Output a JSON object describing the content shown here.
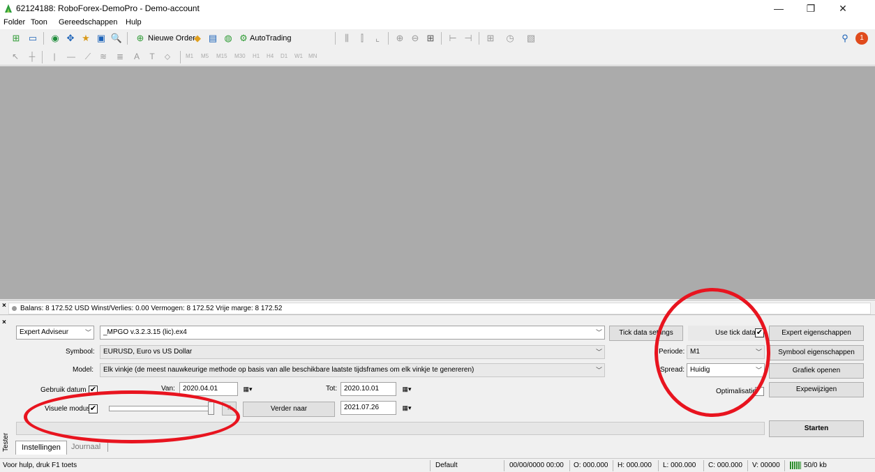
{
  "window": {
    "title": "62124188: RoboForex-DemoPro - Demo-account",
    "minimize": "—",
    "restore": "❐",
    "close": "✕"
  },
  "menu": [
    "Folder",
    "Toon",
    "Gereedschappen",
    "Hulp"
  ],
  "toolbar": {
    "new_order": "Nieuwe Order",
    "autotrading": "AutoTrading",
    "timeframes": [
      "M1",
      "M5",
      "M15",
      "M30",
      "H1",
      "H4",
      "D1",
      "W1",
      "MN"
    ],
    "notification_count": "1"
  },
  "balance": {
    "text": "Balans: 8 172.52 USD  Winst/Verlies: 0.00  Vermogen: 8 172.52  Vrije marge: 8 172.52"
  },
  "tester": {
    "type_select": "Expert Adviseur",
    "expert_file": "_MPGO v.3.2.3.15 (lic).ex4",
    "tick_data_settings": "Tick data settings",
    "use_tick_data_label": "Use tick data",
    "expert_properties": "Expert eigenschappen",
    "symbol_label": "Symbool:",
    "symbol_value": "EURUSD, Euro vs US Dollar",
    "period_label": "Periode:",
    "period_value": "M1",
    "symbol_properties": "Symbool eigenschappen",
    "model_label": "Model:",
    "model_value": "Elk vinkje (de meest nauwkeurige methode op basis van alle beschikbare laatste tijdsframes om elk vinkje te genereren)",
    "spread_label": "Spread:",
    "spread_value": "Huidig",
    "open_chart": "Grafiek openen",
    "use_date_label": "Gebruik datum",
    "from_label": "Van:",
    "from_value": "2020.04.01",
    "to_label": "Tot:",
    "to_value": "2020.10.01",
    "optimization_label": "Optimalisatie",
    "modify_expert": "Expewijzigen",
    "visual_mode_label": "Visuele modus",
    "pause_label": "II",
    "skip_to": "Verder naar",
    "skip_date": "2021.07.26",
    "start": "Starten",
    "tabs": [
      "Instellingen",
      "Journaal"
    ],
    "vertical_label": "Tester",
    "checked_mark": "✔"
  },
  "status": {
    "help": "Voor hulp, druk F1 toets",
    "profile": "Default",
    "datetime": "00/00/0000 00:00",
    "open": "O: 000.000",
    "high": "H: 000.000",
    "low": "L: 000.000",
    "close": "C: 000.000",
    "volume": "V: 00000",
    "traffic": "50/0 kb"
  },
  "colors": {
    "chart_bg": "#ababab",
    "annotation_red": "#e8141f"
  }
}
